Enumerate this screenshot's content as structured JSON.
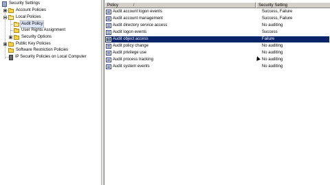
{
  "tree": {
    "items": [
      {
        "label": "Security Settings"
      },
      {
        "label": "Account Policies"
      },
      {
        "label": "Local Policies"
      },
      {
        "label": "Audit Policy"
      },
      {
        "label": "User Rights Assignment"
      },
      {
        "label": "Security Options"
      },
      {
        "label": "Public Key Policies"
      },
      {
        "label": "Software Restriction Policies"
      },
      {
        "label": "IP Security Policies on Local Computer"
      }
    ]
  },
  "list": {
    "columns": [
      {
        "label": "Policy"
      },
      {
        "label": "Security Setting"
      }
    ],
    "sort_indicator": "/",
    "rows": [
      {
        "policy": "Audit account logon events",
        "setting": "Success, Failure"
      },
      {
        "policy": "Audit account management",
        "setting": "Success, Failure"
      },
      {
        "policy": "Audit directory service access",
        "setting": "No auditing"
      },
      {
        "policy": "Audit logon events",
        "setting": "Success"
      },
      {
        "policy": "Audit object access",
        "setting": "Failure"
      },
      {
        "policy": "Audit policy change",
        "setting": "No auditing"
      },
      {
        "policy": "Audit privilege use",
        "setting": "No auditing"
      },
      {
        "policy": "Audit process tracking",
        "setting": "No auditing"
      },
      {
        "policy": "Audit system events",
        "setting": "No auditing"
      }
    ],
    "selected_index": 4
  },
  "colors": {
    "selection": "#0a246a",
    "window_bg": "#d4d0c8",
    "pane_bg": "#ffffff"
  },
  "icons": {
    "root": "shield-icon",
    "folder": "folder-icon",
    "policy": "policy-icon",
    "ipsec": "network-icon"
  }
}
